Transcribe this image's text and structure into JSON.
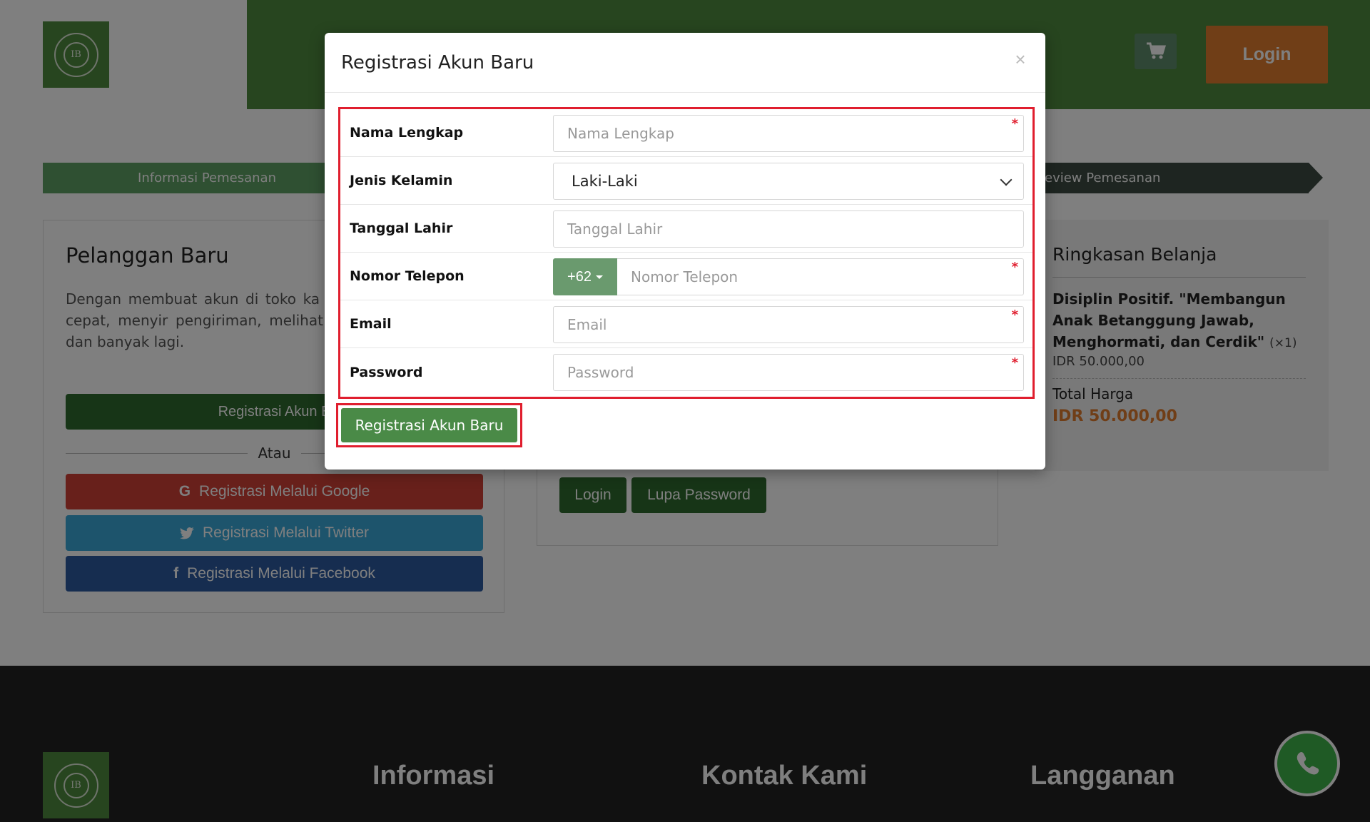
{
  "header": {
    "logo_text": "IB",
    "login_label": "Login",
    "cart_icon": "cart-icon"
  },
  "steps": {
    "step1_label": "Informasi Pemesanan",
    "step3_label": "eview Pemesanan"
  },
  "new_customer": {
    "title": "Pelanggan Baru",
    "description": "Dengan membuat akun di toko ka proses checkout lebih cepat, menyir pengiriman, melihat dan melacak p Anda dan banyak lagi.",
    "register_button": "Registrasi Akun B",
    "or_label": "Atau",
    "google_button": "Registrasi Melalui Google",
    "twitter_button": "Registrasi Melalui Twitter",
    "facebook_button": "Registrasi Melalui Facebook"
  },
  "login_card": {
    "login_button": "Login",
    "forgot_button": "Lupa Password"
  },
  "summary": {
    "title": "Ringkasan Belanja",
    "product_name": "Disiplin Positif. \"Membangun Anak Betanggung Jawab, Menghormati, dan Cerdik\"",
    "product_qty": "(×1)",
    "product_price": "IDR 50.000,00",
    "total_label": "Total Harga",
    "total_value": "IDR 50.000,00"
  },
  "footer": {
    "col1": "Informasi",
    "col2": "Kontak Kami",
    "col3": "Langganan",
    "whatsapp_icon": "whatsapp-icon"
  },
  "modal": {
    "title": "Registrasi Akun Baru",
    "close_label": "×",
    "fields": [
      {
        "label": "Nama Lengkap",
        "placeholder": "Nama Lengkap",
        "required": true
      },
      {
        "label": "Jenis Kelamin",
        "value": "Laki-Laki"
      },
      {
        "label": "Tanggal Lahir",
        "placeholder": "Tanggal Lahir",
        "required": false
      },
      {
        "label": "Nomor Telepon",
        "code": "+62",
        "placeholder": "Nomor Telepon",
        "required": true
      },
      {
        "label": "Email",
        "placeholder": "Email",
        "required": true
      },
      {
        "label": "Password",
        "placeholder": "Password",
        "required": true
      }
    ],
    "required_mark": "*",
    "submit_label": "Registrasi Akun Baru"
  },
  "colors": {
    "brand_green": "#4e8b3e",
    "accent_orange": "#e07d2e",
    "highlight_red": "#e01e2e"
  }
}
